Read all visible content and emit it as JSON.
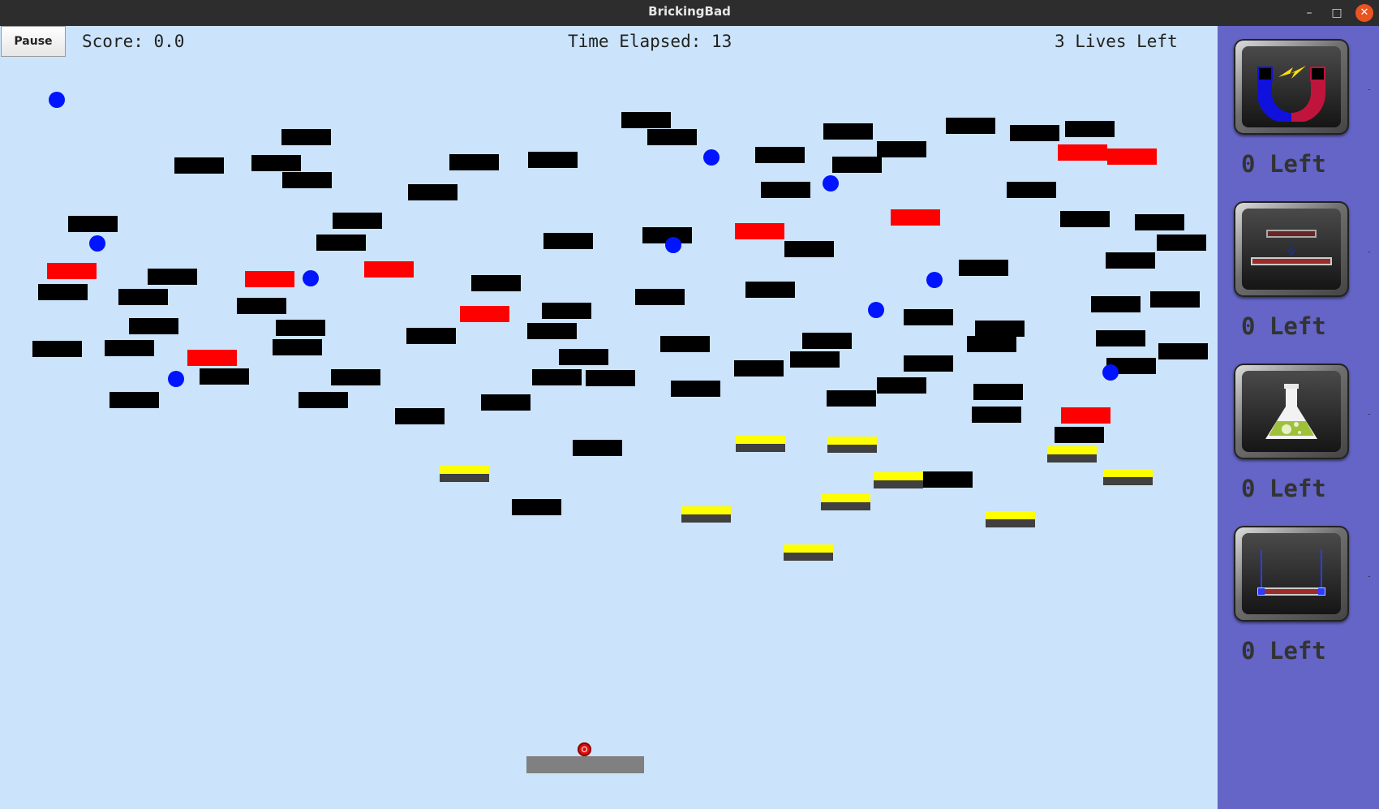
{
  "window": {
    "title": "BrickingBad"
  },
  "hud": {
    "pause_label": "Pause",
    "score_text": "Score: 0.0",
    "time_text": "Time Elapsed: 13",
    "lives_text": "3 Lives Left"
  },
  "colors": {
    "background": "#cbe4fb",
    "sidebar": "#6465c6",
    "simple_brick": "#000000",
    "explosive_brick": "#ff0000",
    "half_metal_brick_top": "#ffff00",
    "half_metal_brick_bottom": "#404040",
    "gift_orb": "#0014ff",
    "paddle": "#808080",
    "ball": "#e01010"
  },
  "abilities": [
    {
      "name": "magnet-icon",
      "count_text": "0 Left"
    },
    {
      "name": "paddle-expand-icon",
      "count_text": "0 Left"
    },
    {
      "name": "chemical-flask-icon",
      "count_text": "0 Left"
    },
    {
      "name": "laser-paddle-icon",
      "count_text": "0 Left"
    }
  ]
}
